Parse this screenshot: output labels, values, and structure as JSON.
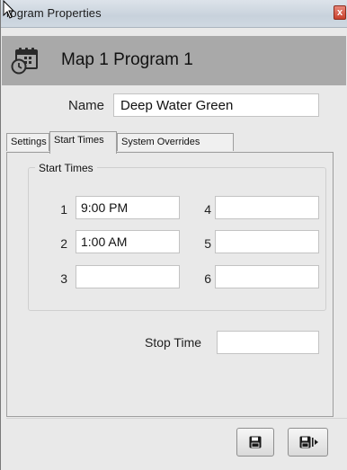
{
  "window": {
    "title": "rogram Properties",
    "close_glyph": "x"
  },
  "header": {
    "icon": "calendar-clock-icon",
    "title": "Map 1 Program 1"
  },
  "name": {
    "label": "Name",
    "value": "Deep Water Green"
  },
  "tabs": [
    {
      "label": "Settings",
      "active": false
    },
    {
      "label": "Start Times",
      "active": true
    },
    {
      "label": "System Overrides",
      "active": false
    }
  ],
  "start_times": {
    "group_title": "Start Times",
    "slots": [
      {
        "number": "1",
        "value": "9:00 PM"
      },
      {
        "number": "2",
        "value": "1:00 AM"
      },
      {
        "number": "3",
        "value": ""
      },
      {
        "number": "4",
        "value": ""
      },
      {
        "number": "5",
        "value": ""
      },
      {
        "number": "6",
        "value": ""
      }
    ]
  },
  "stop_time": {
    "label": "Stop Time",
    "value": ""
  },
  "buttons": {
    "save_icon": "floppy-disk-icon",
    "save_exit_icon": "floppy-disk-exit-icon"
  }
}
